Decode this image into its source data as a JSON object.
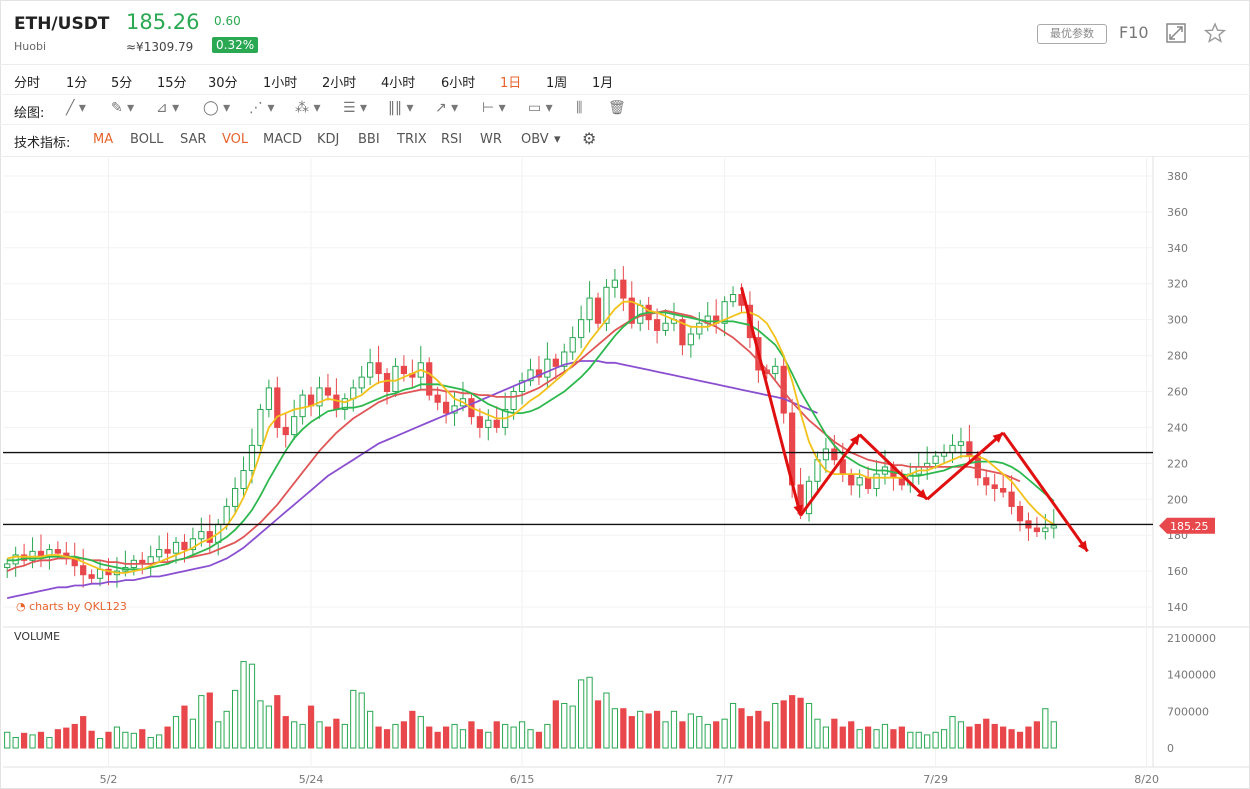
{
  "header": {
    "symbol": "ETH/USDT",
    "exchange": "Huobi",
    "price": "185.26",
    "cny": "≈¥1309.79",
    "change": "0.60",
    "change_pct": "0.32%",
    "params_button": "最优参数",
    "f10": "F10"
  },
  "timeframes": [
    "分时",
    "1分",
    "5分",
    "15分",
    "30分",
    "1小时",
    "2小时",
    "4小时",
    "6小时",
    "1日",
    "1周",
    "1月"
  ],
  "active_timeframe": "1日",
  "draw_label": "绘图:",
  "tools": [
    "line-tool-icon",
    "pencil-tool-icon",
    "channel-tool-icon",
    "shape-tool-icon",
    "trend-tool-icon",
    "pattern-tool-icon",
    "fib-tool-icon",
    "gann-tool-icon",
    "arrow-tool-icon",
    "measure-tool-icon",
    "text-tool-icon",
    "position-tool-icon",
    "trash-icon"
  ],
  "indicators_label": "技术指标:",
  "indicators": [
    "MA",
    "BOLL",
    "SAR",
    "VOL",
    "MACD",
    "KDJ",
    "BBI",
    "TRIX",
    "RSI",
    "WR",
    "OBV"
  ],
  "active_indicators": [
    "MA",
    "VOL"
  ],
  "watermark": "charts by QKL123",
  "volume_title": "VOLUME",
  "current_price_label": "185.25",
  "colors": {
    "up": "#2aa852",
    "down": "#e8474b",
    "ma5": "#f3c21a",
    "ma10": "#2db84d",
    "ma20": "#e05555",
    "ma60": "#8a4fd0",
    "accent": "#e8632c",
    "annotation": "#e01010"
  },
  "chart_data": {
    "type": "candlestick",
    "x_ticks": [
      "5/2",
      "5/24",
      "6/15",
      "7/7",
      "7/29",
      "8/20"
    ],
    "y_ticks": [
      140,
      160,
      180,
      200,
      220,
      240,
      260,
      280,
      300,
      320,
      340,
      360,
      380
    ],
    "ylim": [
      130,
      390
    ],
    "volume_ticks": [
      "2100000",
      "1400000",
      "700000",
      "0"
    ],
    "volume_ylim": [
      0,
      2100000
    ],
    "horizontal_lines": [
      226,
      186
    ],
    "close": [
      164,
      169,
      166,
      171,
      168,
      172,
      170,
      168,
      163,
      158,
      156,
      161,
      158,
      160,
      162,
      166,
      164,
      168,
      172,
      170,
      176,
      172,
      178,
      182,
      176,
      186,
      196,
      206,
      216,
      230,
      250,
      262,
      240,
      236,
      246,
      258,
      252,
      262,
      258,
      250,
      256,
      262,
      268,
      276,
      270,
      260,
      274,
      270,
      268,
      276,
      258,
      254,
      248,
      252,
      256,
      246,
      240,
      244,
      240,
      250,
      260,
      266,
      272,
      268,
      278,
      274,
      282,
      290,
      300,
      312,
      298,
      318,
      322,
      312,
      298,
      308,
      300,
      294,
      298,
      300,
      286,
      292,
      298,
      302,
      298,
      310,
      314,
      308,
      290,
      272,
      270,
      274,
      248,
      208,
      192,
      210,
      222,
      228,
      222,
      214,
      208,
      212,
      206,
      214,
      218,
      212,
      208,
      214,
      218,
      220,
      224,
      226,
      230,
      232,
      224,
      212,
      208,
      206,
      204,
      196,
      188,
      184,
      182,
      184,
      185.25
    ],
    "ma5": [
      167,
      168,
      168,
      168,
      168,
      169,
      169,
      168,
      167,
      165,
      163,
      161,
      160,
      159,
      159,
      160,
      161,
      163,
      165,
      167,
      169,
      171,
      173,
      176,
      178,
      181,
      185,
      192,
      201,
      212,
      226,
      240,
      246,
      248,
      250,
      251,
      252,
      254,
      256,
      255,
      254,
      256,
      258,
      262,
      265,
      266,
      266,
      268,
      270,
      272,
      270,
      266,
      261,
      256,
      254,
      251,
      249,
      247,
      245,
      245,
      247,
      251,
      255,
      258,
      262,
      266,
      270,
      275,
      281,
      288,
      294,
      300,
      306,
      310,
      310,
      308,
      305,
      304,
      302,
      300,
      298,
      296,
      296,
      296,
      298,
      300,
      302,
      304,
      304,
      302,
      298,
      290,
      280,
      266,
      248,
      232,
      222,
      216,
      214,
      214,
      214,
      214,
      212,
      212,
      212,
      212,
      212,
      214,
      216,
      216,
      218,
      220,
      222,
      224,
      224,
      224,
      222,
      218,
      214,
      210,
      204,
      198,
      193,
      189,
      186
    ],
    "ma10": [
      166,
      166,
      167,
      167,
      167,
      168,
      168,
      168,
      168,
      167,
      166,
      164,
      163,
      162,
      161,
      161,
      161,
      162,
      163,
      164,
      166,
      167,
      169,
      171,
      173,
      176,
      179,
      183,
      188,
      194,
      202,
      211,
      219,
      227,
      234,
      239,
      243,
      246,
      249,
      250,
      251,
      251,
      252,
      254,
      256,
      258,
      259,
      261,
      262,
      264,
      264,
      264,
      263,
      262,
      261,
      259,
      256,
      253,
      251,
      249,
      248,
      248,
      249,
      251,
      254,
      257,
      260,
      264,
      268,
      273,
      279,
      285,
      291,
      296,
      300,
      303,
      304,
      304,
      304,
      303,
      302,
      301,
      300,
      299,
      299,
      299,
      299,
      298,
      297,
      294,
      290,
      286,
      279,
      270,
      260,
      252,
      244,
      236,
      230,
      225,
      222,
      219,
      217,
      216,
      216,
      215,
      214,
      213,
      213,
      214,
      215,
      216,
      218,
      219,
      220,
      221,
      221,
      221,
      220,
      218,
      215,
      211,
      207,
      203,
      199
    ],
    "ma20": [
      160,
      162,
      163,
      165,
      166,
      166,
      167,
      167,
      167,
      167,
      166,
      166,
      165,
      165,
      164,
      164,
      164,
      164,
      165,
      165,
      166,
      167,
      168,
      169,
      170,
      172,
      174,
      176,
      179,
      183,
      187,
      192,
      197,
      203,
      209,
      215,
      221,
      227,
      232,
      237,
      241,
      245,
      248,
      251,
      254,
      256,
      258,
      259,
      260,
      261,
      261,
      261,
      260,
      260,
      259,
      259,
      258,
      258,
      257,
      257,
      257,
      258,
      260,
      262,
      265,
      268,
      271,
      274,
      278,
      282,
      286,
      290,
      294,
      297,
      300,
      302,
      303,
      304,
      305,
      304,
      303,
      302,
      300,
      298,
      296,
      293,
      290,
      286,
      282,
      277,
      272,
      266,
      260,
      254,
      249,
      244,
      240,
      236,
      232,
      229,
      226,
      224,
      222,
      221,
      220,
      219,
      219,
      218,
      218,
      218,
      218,
      218,
      218,
      218,
      218,
      217,
      216,
      215,
      214,
      212,
      210
    ],
    "ma60": [
      145,
      146,
      147,
      148,
      149,
      150,
      151,
      151,
      152,
      152,
      153,
      153,
      154,
      154,
      155,
      155,
      156,
      157,
      157,
      158,
      159,
      160,
      161,
      162,
      163,
      165,
      167,
      170,
      173,
      177,
      181,
      185,
      189,
      193,
      197,
      201,
      205,
      209,
      213,
      216,
      219,
      222,
      225,
      228,
      231,
      233,
      235,
      237,
      239,
      241,
      243,
      245,
      247,
      249,
      251,
      253,
      255,
      257,
      259,
      261,
      263,
      265,
      267,
      269,
      271,
      273,
      275,
      276,
      277,
      277,
      277,
      276,
      276,
      275,
      274,
      273,
      272,
      271,
      270,
      269,
      268,
      267,
      266,
      265,
      264,
      263,
      262,
      261,
      260,
      259,
      258,
      257,
      256,
      254,
      252,
      250,
      248
    ],
    "volume": [
      300000,
      200000,
      280000,
      250000,
      300000,
      200000,
      350000,
      380000,
      450000,
      600000,
      320000,
      180000,
      300000,
      400000,
      300000,
      280000,
      350000,
      200000,
      250000,
      400000,
      600000,
      800000,
      550000,
      1000000,
      1050000,
      500000,
      700000,
      1100000,
      1650000,
      1600000,
      900000,
      800000,
      1000000,
      600000,
      500000,
      450000,
      800000,
      500000,
      400000,
      550000,
      450000,
      1100000,
      1050000,
      700000,
      400000,
      350000,
      450000,
      500000,
      700000,
      600000,
      400000,
      300000,
      400000,
      450000,
      350000,
      500000,
      350000,
      300000,
      500000,
      450000,
      400000,
      500000,
      350000,
      300000,
      450000,
      900000,
      850000,
      800000,
      1300000,
      1350000,
      900000,
      1050000,
      750000,
      750000,
      600000,
      700000,
      650000,
      700000,
      500000,
      700000,
      500000,
      650000,
      600000,
      450000,
      500000,
      550000,
      850000,
      750000,
      600000,
      700000,
      500000,
      850000,
      900000,
      1000000,
      950000,
      850000,
      550000,
      400000,
      550000,
      400000,
      500000,
      350000,
      400000,
      350000,
      450000,
      350000,
      400000,
      300000,
      300000,
      250000,
      300000,
      350000,
      600000,
      500000,
      400000,
      450000,
      550000,
      450000,
      400000,
      350000,
      300000,
      400000,
      500000,
      750000,
      500000,
      300000,
      50000
    ]
  }
}
